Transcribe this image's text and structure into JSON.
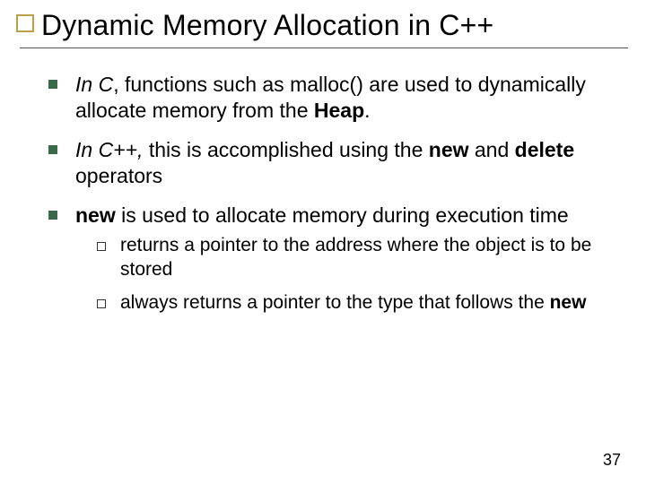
{
  "title": "Dynamic Memory Allocation in C++",
  "bullets": {
    "b1": {
      "lead": "In C",
      "rest": ", functions such as malloc() are used to dynamically allocate memory from the ",
      "heap": "Heap",
      "tail": "."
    },
    "b2": {
      "lead": "In C++,",
      "rest1": " this is accomplished using the ",
      "new": "new",
      "rest2": " and ",
      "delete": "delete",
      "rest3": " operators"
    },
    "b3": {
      "new": "new",
      "rest": " is used to allocate memory during execution time"
    }
  },
  "sub": {
    "s1": "returns a pointer to the address where the object is to be stored",
    "s2a": "always returns a pointer to the type that follows the ",
    "s2b": "new"
  },
  "page": "37"
}
